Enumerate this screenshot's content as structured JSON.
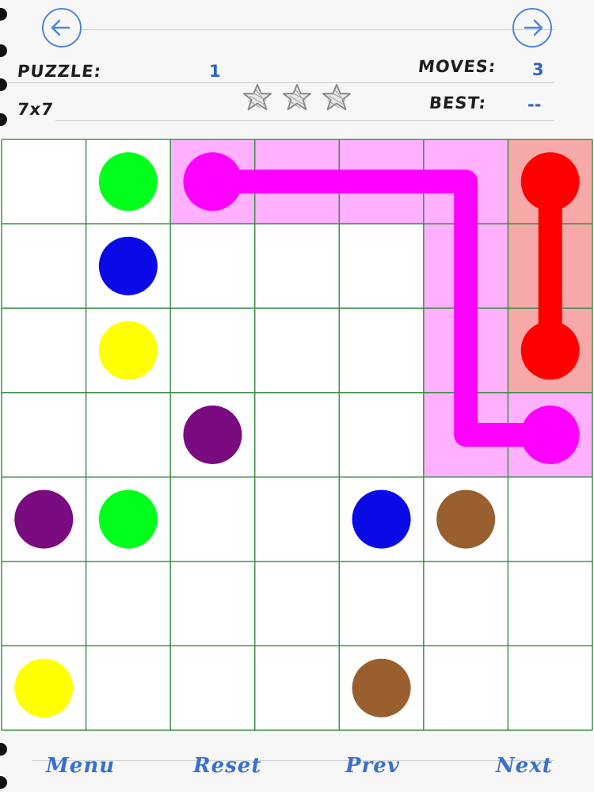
{
  "header": {
    "prev_arrow_icon": "left-arrow-icon",
    "next_arrow_icon": "right-arrow-icon",
    "puzzle_label": "PUZZLE:",
    "puzzle_value": "1",
    "size_label": "7x7",
    "moves_label": "MOVES:",
    "moves_value": "3",
    "best_label": "BEST:",
    "best_value": "--",
    "stars": 3,
    "stars_earned": 0
  },
  "board": {
    "rows": 7,
    "cols": 7,
    "grid_color": "#3f8f4c",
    "dots": [
      {
        "color": "green",
        "hex": "#00ff1a",
        "row": 0,
        "col": 1
      },
      {
        "color": "magenta",
        "hex": "#ff00ff",
        "row": 0,
        "col": 2
      },
      {
        "color": "red",
        "hex": "#ff0000",
        "row": 0,
        "col": 6
      },
      {
        "color": "blue",
        "hex": "#0a0ae6",
        "row": 1,
        "col": 1
      },
      {
        "color": "yellow",
        "hex": "#ffff00",
        "row": 2,
        "col": 1
      },
      {
        "color": "red",
        "hex": "#ff0000",
        "row": 2,
        "col": 6
      },
      {
        "color": "purple",
        "hex": "#7a0a7f",
        "row": 3,
        "col": 2
      },
      {
        "color": "magenta",
        "hex": "#ff00ff",
        "row": 3,
        "col": 6
      },
      {
        "color": "purple",
        "hex": "#7a0a7f",
        "row": 4,
        "col": 0
      },
      {
        "color": "green",
        "hex": "#00ff1a",
        "row": 4,
        "col": 1
      },
      {
        "color": "blue",
        "hex": "#0a0ae6",
        "row": 4,
        "col": 4
      },
      {
        "color": "brown",
        "hex": "#9a5f2e",
        "row": 4,
        "col": 5
      },
      {
        "color": "yellow",
        "hex": "#ffff00",
        "row": 6,
        "col": 0
      },
      {
        "color": "brown",
        "hex": "#9a5f2e",
        "row": 6,
        "col": 4
      }
    ],
    "paths": [
      {
        "color": "magenta",
        "hex": "#ff00ff",
        "fill": "#ffb0ff",
        "cells": [
          [
            0,
            2
          ],
          [
            0,
            3
          ],
          [
            0,
            4
          ],
          [
            0,
            5
          ],
          [
            1,
            5
          ],
          [
            2,
            5
          ],
          [
            3,
            5
          ],
          [
            3,
            6
          ]
        ]
      },
      {
        "color": "red",
        "hex": "#ff0000",
        "fill": "#f7a8a8",
        "cells": [
          [
            0,
            6
          ],
          [
            1,
            6
          ],
          [
            2,
            6
          ]
        ]
      }
    ]
  },
  "footer": {
    "menu": "Menu",
    "reset": "Reset",
    "prev": "Prev",
    "next": "Next"
  }
}
